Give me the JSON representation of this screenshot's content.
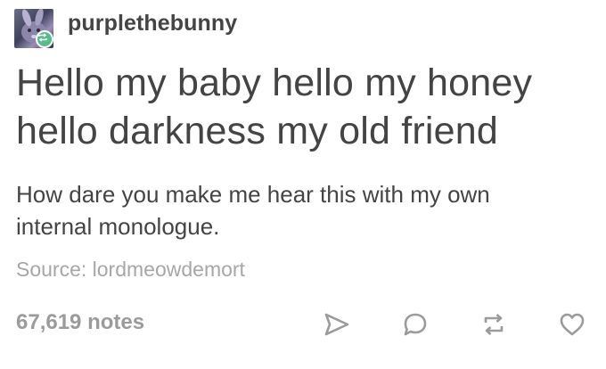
{
  "post": {
    "username": "purplethebunny",
    "title_lines": [
      "Hello my baby hello my honey",
      "hello darkness my old friend"
    ],
    "body_lines": [
      "How dare you make me hear this with my own",
      "internal monologue."
    ],
    "source": {
      "label": "Source:",
      "name": "lordmeowdemort"
    },
    "notes": "67,619 notes"
  },
  "icons": {
    "avatar": "avatar",
    "reblog_badge": "reblog-icon",
    "share": "share-icon",
    "reply": "reply-icon",
    "reblog": "reblog-icon",
    "like": "heart-icon"
  },
  "colors": {
    "text": "#444444",
    "muted": "#a7a7a7",
    "notes": "#9b9b9b",
    "reblog_green": "#56bc8a"
  }
}
